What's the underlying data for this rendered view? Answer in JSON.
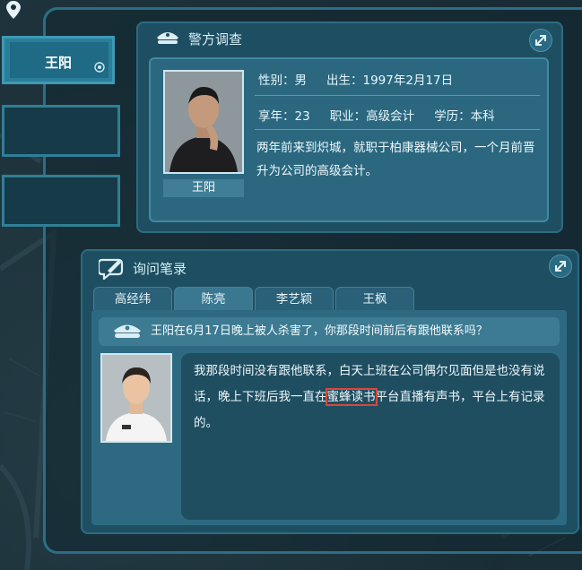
{
  "side_tabs": [
    {
      "label": "王阳",
      "active": true
    },
    {
      "label": "",
      "active": false
    },
    {
      "label": "",
      "active": false
    }
  ],
  "police_panel": {
    "title": "警方调查",
    "name": "王阳",
    "gender_label": "性别：男",
    "birth_label": "出生：1997年2月17日",
    "age_label": "享年：23",
    "job_label": "职业：高级会计",
    "edu_label": "学历：本科",
    "description": "两年前来到炽城，就职于柏康器械公司，一个月前晋升为公司的高级会计。"
  },
  "interview_panel": {
    "title": "询问笔录",
    "tabs": [
      "高经纬",
      "陈亮",
      "李艺颖",
      "王枫"
    ],
    "active_tab": "陈亮",
    "question": "王阳在6月17日晚上被人杀害了，你那段时间前后有跟他联系吗？",
    "answer_before": "我那段时间没有跟他联系，白天上班在公司偶尔见面但是也没有说话，晚上下班后我一直在",
    "answer_highlight": "蜜蜂读书",
    "answer_after": "平台直播有声书，平台上有记录的。"
  },
  "colors": {
    "accent": "#2c6c82",
    "highlight": "#d9483b"
  }
}
